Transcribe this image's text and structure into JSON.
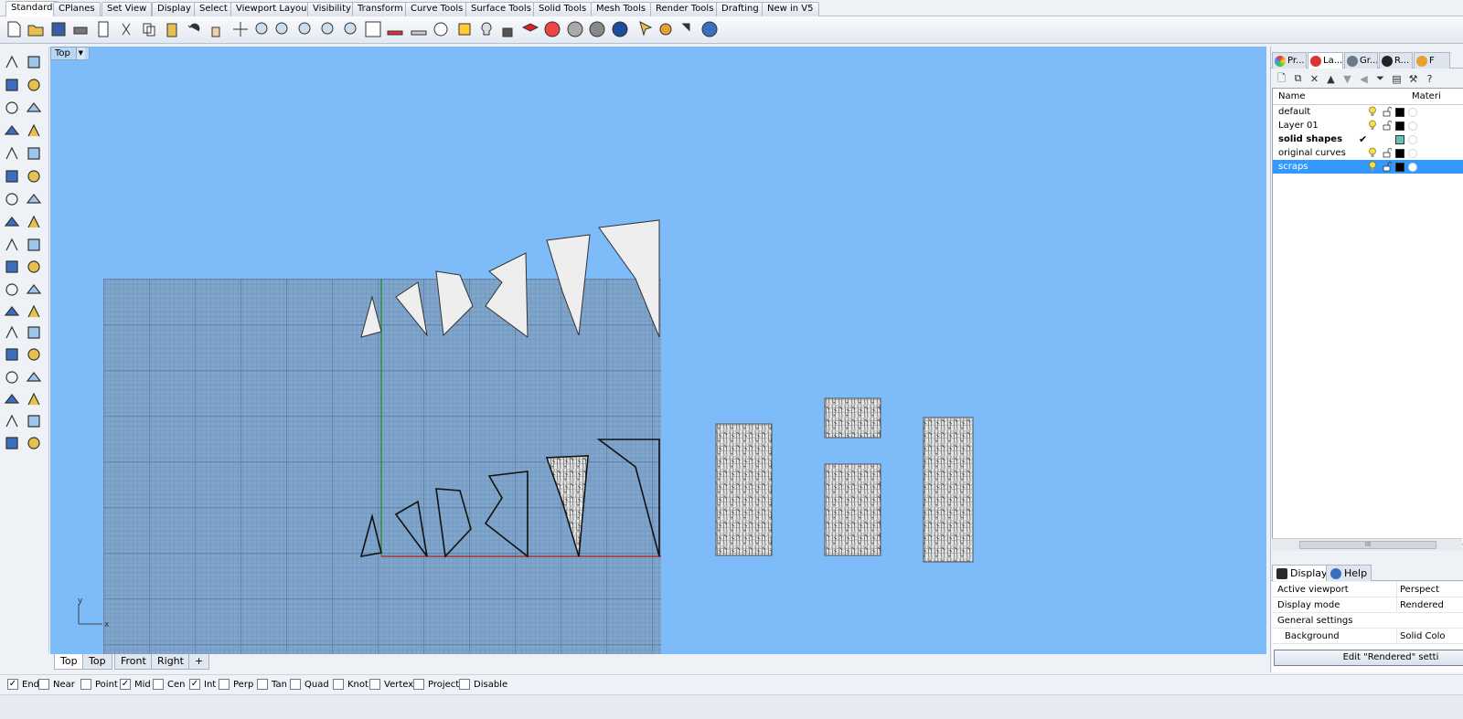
{
  "top_tabs": [
    "Standard",
    "CPlanes",
    "Set View",
    "Display",
    "Select",
    "Viewport Layout",
    "Visibility",
    "Transform",
    "Curve Tools",
    "Surface Tools",
    "Solid Tools",
    "Mesh Tools",
    "Render Tools",
    "Drafting",
    "New in V5"
  ],
  "viewport": {
    "title": "Top",
    "axis_x": "x",
    "axis_y": "y"
  },
  "view_tabs": [
    "Top",
    "Top",
    "Front",
    "Right"
  ],
  "view_tab_add": "+",
  "osnaps": [
    {
      "label": "End",
      "checked": true
    },
    {
      "label": "Near",
      "checked": false
    },
    {
      "label": "Point",
      "checked": false
    },
    {
      "label": "Mid",
      "checked": true
    },
    {
      "label": "Cen",
      "checked": false
    },
    {
      "label": "Int",
      "checked": true
    },
    {
      "label": "Perp",
      "checked": false
    },
    {
      "label": "Tan",
      "checked": false
    },
    {
      "label": "Quad",
      "checked": false
    },
    {
      "label": "Knot",
      "checked": false
    },
    {
      "label": "Vertex",
      "checked": false
    },
    {
      "label": "Project",
      "checked": false
    },
    {
      "label": "Disable",
      "checked": false
    }
  ],
  "right_panel": {
    "tabs": [
      "Pr...",
      "La...",
      "Gr...",
      "R...",
      "F"
    ],
    "layers": {
      "col_name": "Name",
      "col_material": "Materi",
      "rows": [
        {
          "name": "default",
          "current": false,
          "selected": false,
          "color": "#000000",
          "bold": false
        },
        {
          "name": "Layer 01",
          "current": false,
          "selected": false,
          "color": "#000000",
          "bold": false
        },
        {
          "name": "solid shapes",
          "current": true,
          "selected": false,
          "color": "#5fc4b8",
          "bold": true
        },
        {
          "name": "original curves",
          "current": false,
          "selected": false,
          "color": "#000000",
          "bold": false
        },
        {
          "name": "scraps",
          "current": false,
          "selected": true,
          "color": "#000000",
          "bold": false
        }
      ],
      "scroll_thumb": "III"
    },
    "display_tabs": [
      "Display",
      "Help"
    ],
    "display": {
      "rows": [
        {
          "key": "Active viewport",
          "value": "Perspect"
        },
        {
          "key": "Display mode",
          "value": "Rendered"
        },
        {
          "key": "General settings",
          "value": ""
        },
        {
          "key": "Background",
          "value": "Solid Colo"
        }
      ],
      "edit_button": "Edit \"Rendered\" setti"
    }
  },
  "colors": {
    "viewport_bg": "#7dbbf9",
    "grid_bg": "#7fa5cc",
    "x_axis": "#b0211c",
    "y_axis": "#1f8a2a",
    "selected_layer": "#3399ff"
  }
}
